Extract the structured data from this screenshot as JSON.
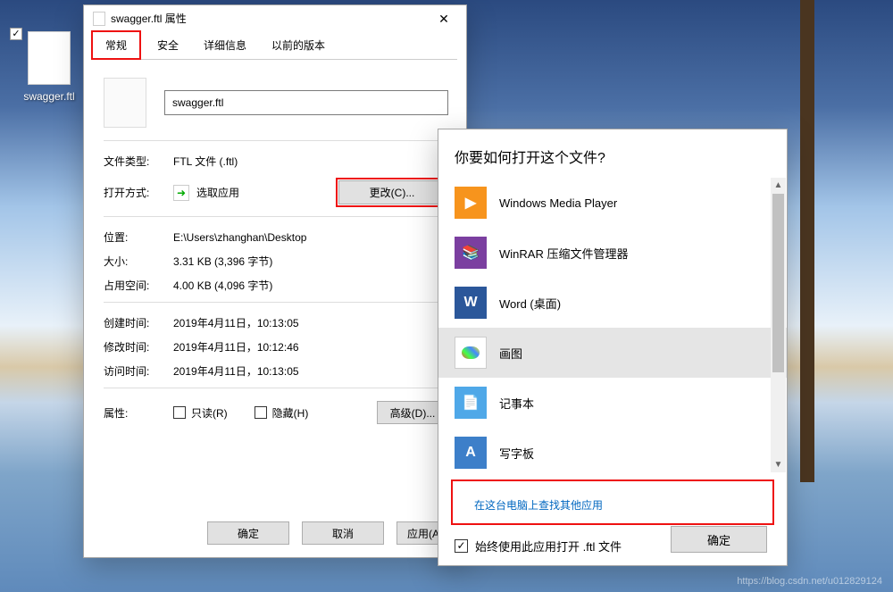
{
  "desktop_icon": {
    "label": "swagger.ftl"
  },
  "props": {
    "title": "swagger.ftl 属性",
    "tabs": [
      "常规",
      "安全",
      "详细信息",
      "以前的版本"
    ],
    "filename": "swagger.ftl",
    "rows": {
      "filetype_k": "文件类型:",
      "filetype_v": "FTL 文件 (.ftl)",
      "openwith_k": "打开方式:",
      "openwith_v": "选取应用",
      "change_btn": "更改(C)...",
      "location_k": "位置:",
      "location_v": "E:\\Users\\zhanghan\\Desktop",
      "size_k": "大小:",
      "size_v": "3.31 KB (3,396 字节)",
      "sizeon_k": "占用空间:",
      "sizeon_v": "4.00 KB (4,096 字节)",
      "created_k": "创建时间:",
      "created_v": "2019年4月11日，10:13:05",
      "modified_k": "修改时间:",
      "modified_v": "2019年4月11日，10:12:46",
      "accessed_k": "访问时间:",
      "accessed_v": "2019年4月11日，10:13:05",
      "attrs_k": "属性:",
      "readonly": "只读(R)",
      "hidden": "隐藏(H)",
      "advanced": "高级(D)..."
    },
    "buttons": {
      "ok": "确定",
      "cancel": "取消",
      "apply": "应用(A"
    }
  },
  "openwith": {
    "heading": "你要如何打开这个文件?",
    "apps": [
      {
        "name": "Windows Media Player",
        "icon": "wmp"
      },
      {
        "name": "WinRAR 压缩文件管理器",
        "icon": "rar"
      },
      {
        "name": "Word (桌面)",
        "icon": "word"
      },
      {
        "name": "画图",
        "icon": "paint",
        "selected": true
      },
      {
        "name": "记事本",
        "icon": "note"
      },
      {
        "name": "写字板",
        "icon": "write"
      }
    ],
    "more_apps": "在这台电脑上查找其他应用",
    "always_label": "始终使用此应用打开 .ftl 文件",
    "always_checked": true,
    "ok": "确定"
  },
  "watermark": "https://blog.csdn.net/u012829124"
}
